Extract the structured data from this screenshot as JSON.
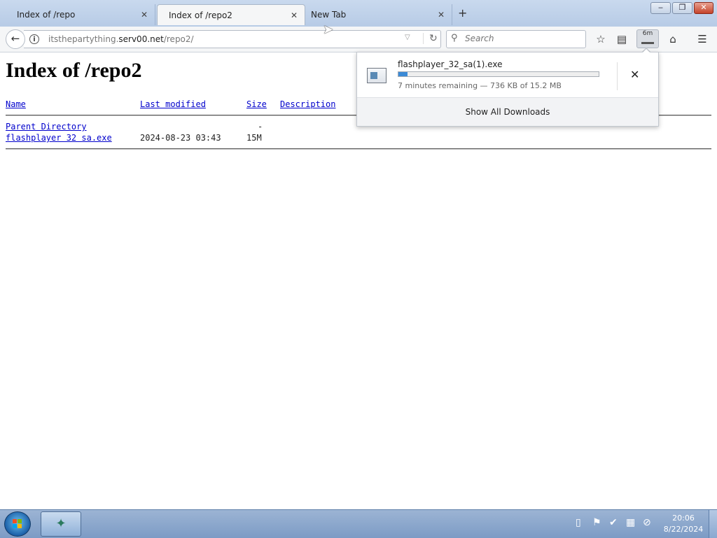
{
  "tabs": [
    {
      "title": "Index of /repo"
    },
    {
      "title": "Index of /repo2"
    },
    {
      "title": "New Tab"
    }
  ],
  "window_controls": {
    "minimize": "‒",
    "maximize": "❐",
    "close": "✕"
  },
  "navbar": {
    "url_prefix": "itsthepartything.",
    "url_host": "serv00.net",
    "url_path": "/repo2/",
    "search_placeholder": "Search",
    "download_badge": "6m"
  },
  "page": {
    "heading": "Index of /repo2",
    "columns": {
      "name": "Name",
      "modified": "Last modified",
      "size": "Size",
      "description": "Description"
    },
    "rows": [
      {
        "name": "Parent Directory",
        "modified": "",
        "size": "-"
      },
      {
        "name": "flashplayer 32 sa.exe",
        "modified": "2024-08-23 03:43",
        "size": "15M"
      }
    ]
  },
  "download_panel": {
    "filename": "flashplayer_32_sa(1).exe",
    "status": "7 minutes remaining — 736 KB of 15.2 MB",
    "progress_fraction": 0.047,
    "show_all": "Show All Downloads",
    "cancel": "✕"
  },
  "taskbar": {
    "time": "20:06",
    "date": "8/22/2024"
  },
  "colors": {
    "link": "#0000cc",
    "progress": "#3b8ad6",
    "taskbar": "#8aa6cc"
  }
}
